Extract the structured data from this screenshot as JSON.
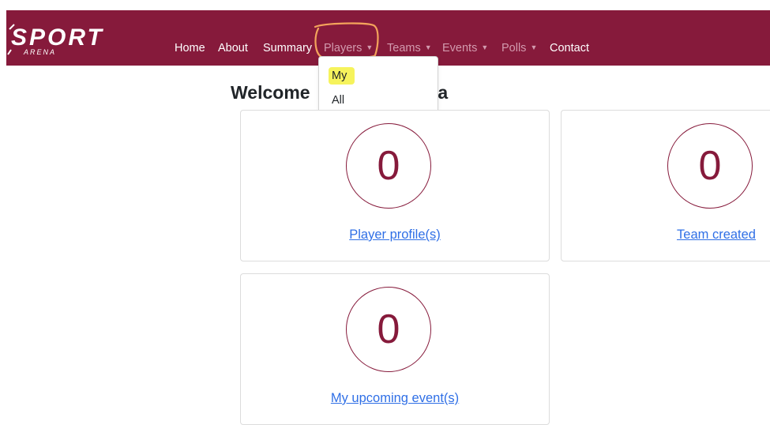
{
  "navbar": {
    "brand": {
      "alt": "SPORT ARENA",
      "logo_text": "SPORT",
      "logo_subtext": "ARENA",
      "icon": "sport-arena-logo"
    },
    "links": [
      {
        "label": "Home"
      },
      {
        "label": "About"
      },
      {
        "label": "Summary"
      },
      {
        "label": "Players",
        "dropdown": true,
        "open": true
      },
      {
        "label": "Teams",
        "dropdown": true
      },
      {
        "label": "Events",
        "dropdown": true
      },
      {
        "label": "Polls",
        "dropdown": true
      },
      {
        "label": "Contact"
      }
    ],
    "caret_glyph": "▼",
    "colors": {
      "bar": "#861a3b",
      "text": "#ffffff",
      "muted_text": "#d29aae"
    }
  },
  "players_menu": {
    "items": [
      {
        "label": "My",
        "highlighted": true
      },
      {
        "label": "All"
      }
    ]
  },
  "page": {
    "heading_left": "Welcome",
    "heading_right": "ena"
  },
  "cards": [
    {
      "count": "0",
      "link": "Player profile(s)"
    },
    {
      "count": "0",
      "link": "Team created"
    },
    {
      "count": "0",
      "link": "My upcoming event(s)"
    }
  ],
  "colors": {
    "accent": "#861a3b",
    "link": "#2f6fe6",
    "highlight": "#f5f24a",
    "annotation": "#f3a35b"
  }
}
